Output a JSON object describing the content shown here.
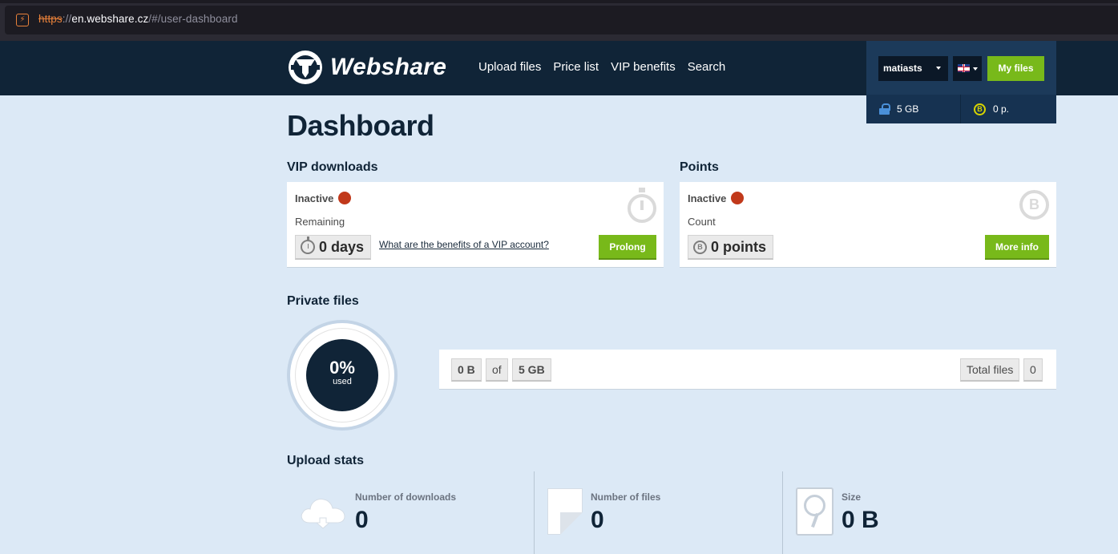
{
  "browser": {
    "url_scheme": "https",
    "url_separator": "://",
    "url_host": "en.webshare.cz",
    "url_path": "/#/user-dashboard"
  },
  "header": {
    "logo_text": "Webshare",
    "nav": [
      "Upload files",
      "Price list",
      "VIP benefits",
      "Search"
    ],
    "username": "matiasts",
    "my_files_label": "My files",
    "storage_quota": "5 GB",
    "points_balance": "0 p.",
    "colors": {
      "accent_green": "#78b91a",
      "header_bg": "#102437",
      "status_inactive": "#c1391b"
    }
  },
  "page_title": "Dashboard",
  "vip": {
    "title": "VIP downloads",
    "status": "Inactive",
    "remaining_label": "Remaining",
    "remaining_value": "0 days",
    "benefits_link": "What are the benefits of a VIP account?",
    "prolong_label": "Prolong"
  },
  "points": {
    "title": "Points",
    "status": "Inactive",
    "count_label": "Count",
    "count_value": "0 points",
    "more_info_label": "More info",
    "coin_glyph": "B"
  },
  "private_files": {
    "title": "Private files",
    "used_percent": "0%",
    "used_label": "used",
    "used_size": "0 B",
    "of_label": "of",
    "total_size": "5 GB",
    "total_files_label": "Total files",
    "total_files_value": "0"
  },
  "upload_stats": {
    "title": "Upload stats",
    "downloads_label": "Number of downloads",
    "downloads_value": "0",
    "files_label": "Number of files",
    "files_value": "0",
    "size_label": "Size",
    "size_value": "0 B"
  }
}
